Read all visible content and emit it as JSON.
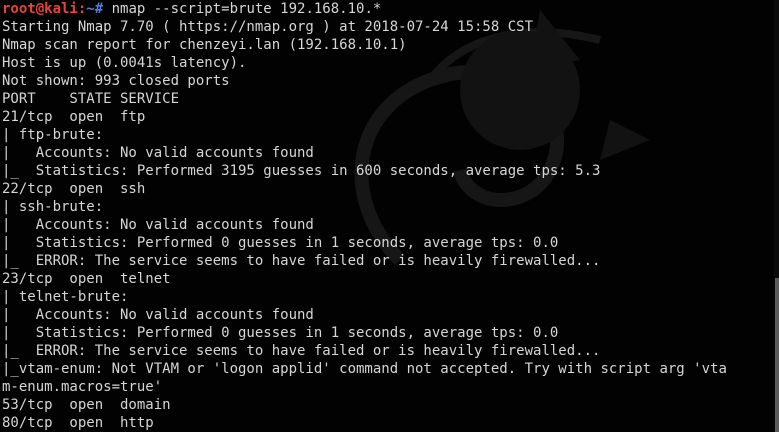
{
  "prompt": {
    "user_host": "root@kali",
    "separator": ":",
    "path_symbol": "~#",
    "command": " nmap --script=brute 192.168.10.*"
  },
  "output_lines": [
    "Starting Nmap 7.70 ( https://nmap.org ) at 2018-07-24 15:58 CST",
    "Nmap scan report for chenzeyi.lan (192.168.10.1)",
    "Host is up (0.0041s latency).",
    "Not shown: 993 closed ports",
    "PORT    STATE SERVICE",
    "21/tcp  open  ftp",
    "| ftp-brute:",
    "|   Accounts: No valid accounts found",
    "|_  Statistics: Performed 3195 guesses in 600 seconds, average tps: 5.3",
    "22/tcp  open  ssh",
    "| ssh-brute:",
    "|   Accounts: No valid accounts found",
    "|   Statistics: Performed 0 guesses in 1 seconds, average tps: 0.0",
    "|_  ERROR: The service seems to have failed or is heavily firewalled...",
    "23/tcp  open  telnet",
    "| telnet-brute:",
    "|   Accounts: No valid accounts found",
    "|   Statistics: Performed 0 guesses in 1 seconds, average tps: 0.0",
    "|_  ERROR: The service seems to have failed or is heavily firewalled...",
    "|_vtam-enum: Not VTAM or 'logon applid' command not accepted. Try with script arg 'vta",
    "m-enum.macros=true'",
    "53/tcp  open  domain",
    "80/tcp  open  http"
  ],
  "colors": {
    "background": "#020202",
    "text": "#d6d6d6",
    "prompt_user": "#e8443a",
    "prompt_path": "#4f7fe0"
  },
  "icons": {
    "watermark": "kali-dragon-watermark-icon"
  }
}
